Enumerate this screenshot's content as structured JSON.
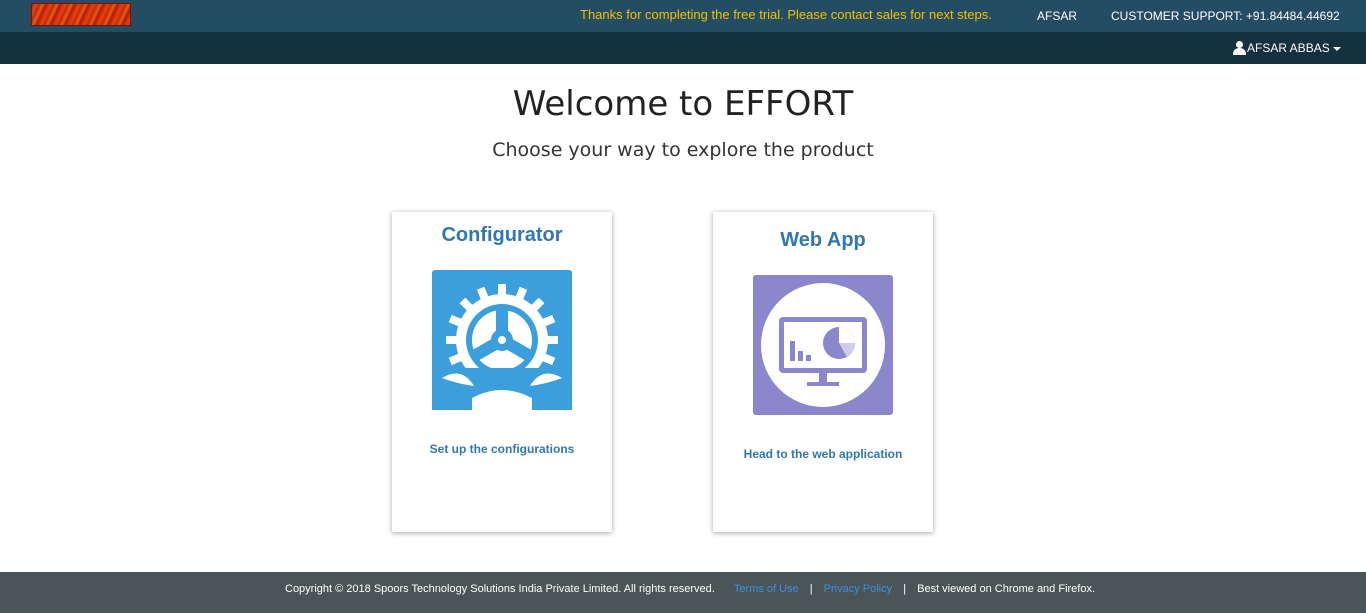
{
  "header": {
    "trial_message": "Thanks for completing the free trial. Please contact sales for next steps.",
    "user_short": "AFSAR",
    "support": "CUSTOMER SUPPORT: +91.84484.44692"
  },
  "navbar": {
    "user_name": "AFSAR ABBAS"
  },
  "main": {
    "title": "Welcome to EFFORT",
    "subtitle": "Choose your way to explore the product"
  },
  "cards": [
    {
      "title": "Configurator",
      "description": "Set up the configurations",
      "icon": "gear-icon",
      "color": "#3a9fdc"
    },
    {
      "title": "Web App",
      "description": "Head to the web application",
      "icon": "monitor-chart-icon",
      "color": "#8b87cc"
    }
  ],
  "footer": {
    "copyright": "Copyright © 2018 Spoors Technology Solutions India Private Limited. All rights reserved.",
    "terms": "Terms of Use",
    "privacy": "Privacy Policy",
    "browsers": "Best viewed on Chrome and Firefox.",
    "separator": "|"
  },
  "colors": {
    "topbar": "#244d63",
    "navbar": "#15303f",
    "accent": "#3277b0",
    "trial_message": "#f0c000",
    "footer": "#4a5558"
  }
}
